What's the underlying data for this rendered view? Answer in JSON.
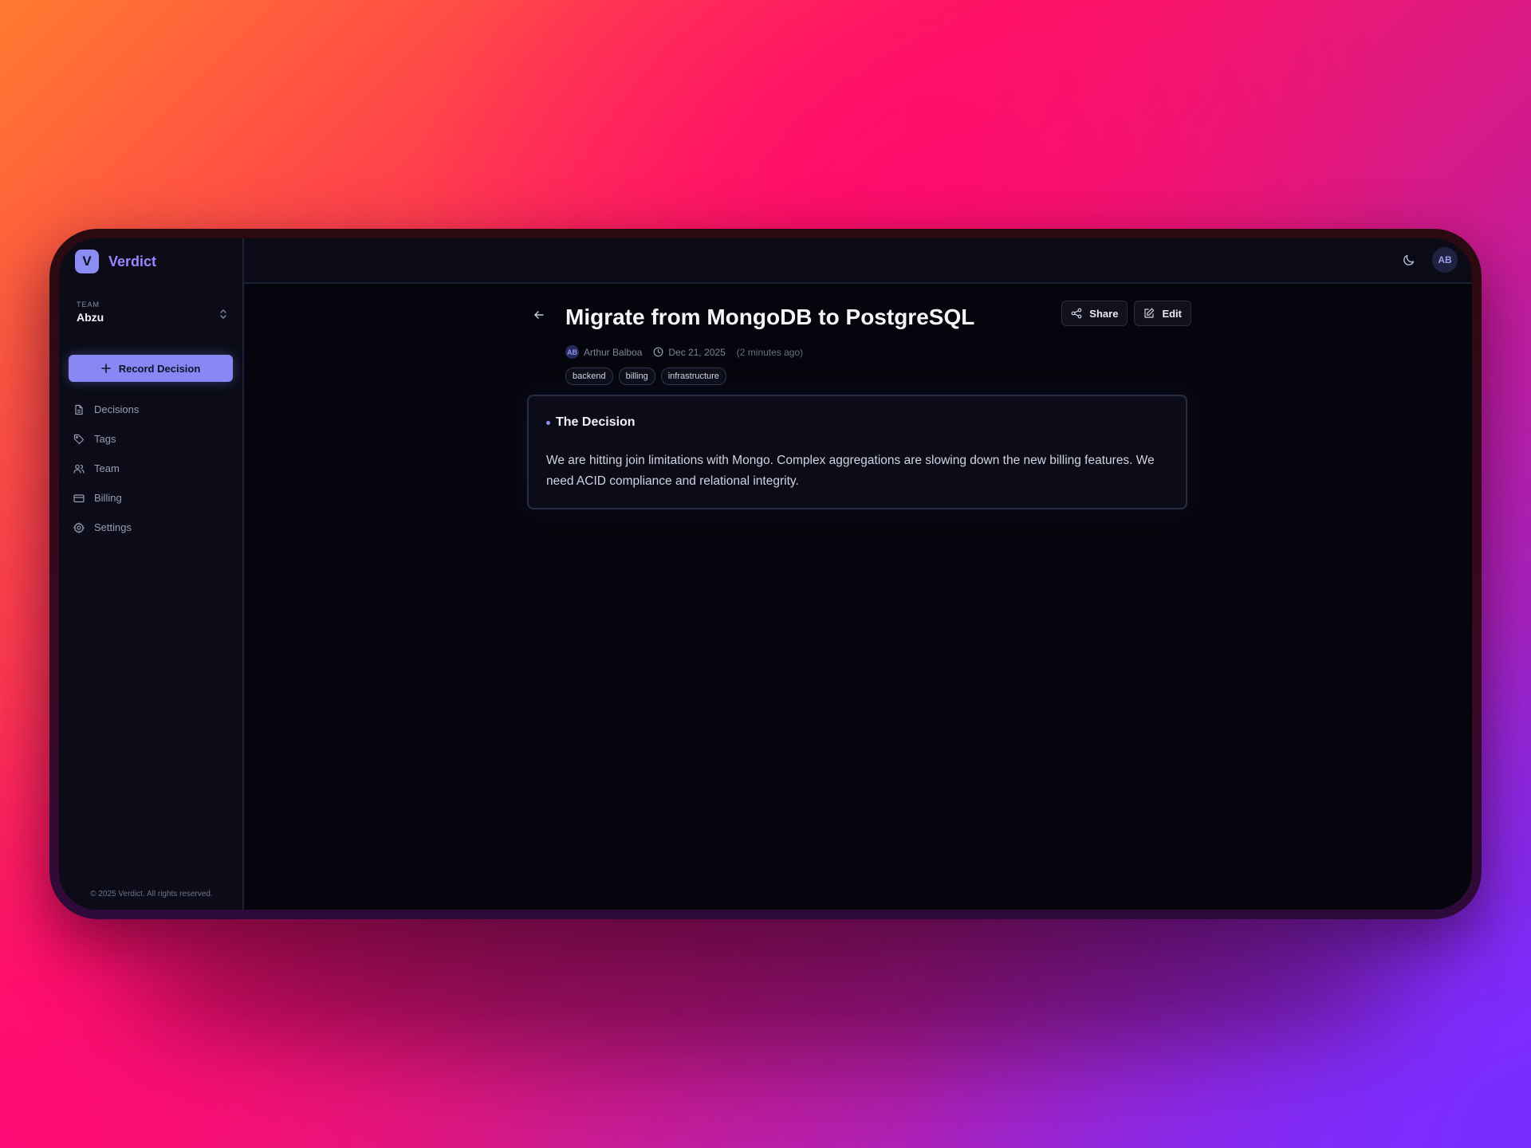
{
  "brand": {
    "logo_letter": "V",
    "name": "Verdict"
  },
  "team": {
    "label": "TEAM",
    "name": "Abzu"
  },
  "sidebar": {
    "record_button": "Record Decision",
    "items": [
      {
        "label": "Decisions",
        "icon": "file-text-icon"
      },
      {
        "label": "Tags",
        "icon": "tag-icon"
      },
      {
        "label": "Team",
        "icon": "users-icon"
      },
      {
        "label": "Billing",
        "icon": "credit-card-icon"
      },
      {
        "label": "Settings",
        "icon": "gear-icon"
      }
    ],
    "footer": "© 2025 Verdict. All rights reserved."
  },
  "topbar": {
    "avatar_initials": "AB",
    "theme_icon": "moon-icon"
  },
  "decision": {
    "title": "Migrate from MongoDB to PostgreSQL",
    "author_initials": "AB",
    "author": "Arthur Balboa",
    "date": "Dec 21, 2025",
    "relative_time": "(2 minutes ago)",
    "tags": [
      "backend",
      "billing",
      "infrastructure"
    ],
    "share_label": "Share",
    "edit_label": "Edit",
    "section_heading": "The Decision",
    "section_body": "We are hitting join limitations with Mongo. Complex aggregations are slowing down the new billing features. We need ACID compliance and relational integrity."
  },
  "colors": {
    "accent": "#8888f5",
    "brand_text": "#9a86ff",
    "screen_bg": "#05060d",
    "sidebar_bg": "#0b0c17"
  }
}
